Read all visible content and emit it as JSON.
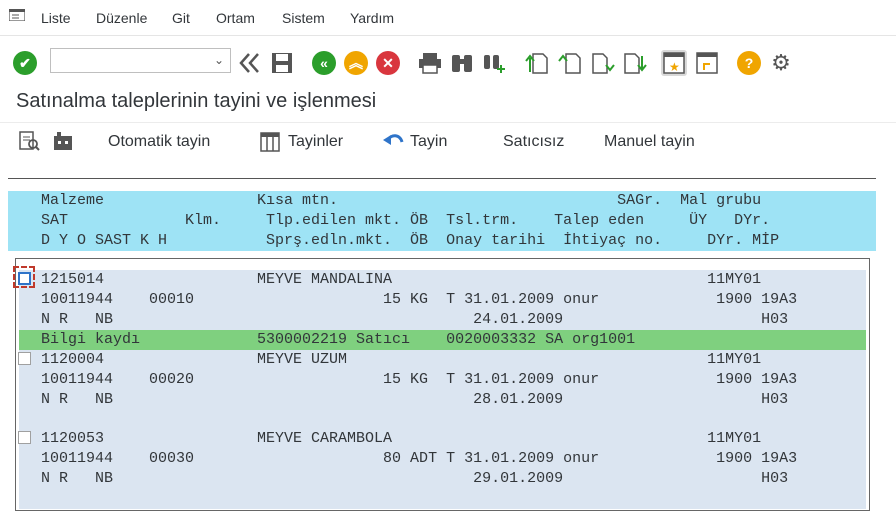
{
  "menu": [
    "Liste",
    "Düzenle",
    "Git",
    "Ortam",
    "Sistem",
    "Yardım"
  ],
  "toolbar": {
    "command_value": "",
    "colors": {
      "green": "#2b9e2b",
      "orange": "#f0a500",
      "red": "#d9363e",
      "gray": "#555555"
    }
  },
  "title": "Satınalma taleplerinin tayini ve işlenmesi",
  "app_toolbar": {
    "otomatik": "Otomatik tayin",
    "tayinler": "Tayinler",
    "tayin": "Tayin",
    "saticisiz": "Satıcısız",
    "manuel": "Manuel tayin"
  },
  "header": {
    "row1": "Malzeme                 Kısa mtn.                               SAGr.  Mal grubu",
    "row2": "SAT             Klm.     Tlp.edilen mkt. ÖB  Tsl.trm.    Talep eden     ÜY   DYr.",
    "row3": "D Y O SAST K H           Sprş.edln.mkt.  ÖB  Onay tarihi  İhtiyaç no.     DYr. MİP"
  },
  "items": [
    {
      "line1": "1215014                 MEYVE MANDALINA                                   11MY01",
      "line2": "10011944    00010                     15 KG  T 31.01.2009 onur             1900 19A3",
      "line3": "N R   NB                                        24.01.2009                      H03",
      "info": "Bilgi kaydı             5300002219 Satıcı    0020003332 SA org1001"
    },
    {
      "line1": "1120004                 MEYVE UZUM                                        11MY01",
      "line2": "10011944    00020                     15 KG  T 31.01.2009 onur             1900 19A3",
      "line3": "N R   NB                                        28.01.2009                      H03"
    },
    {
      "line1": "1120053                 MEYVE CARAMBOLA                                   11MY01",
      "line2": "10011944    00030                     80 ADT T 31.01.2009 onur             1900 19A3",
      "line3": "N R   NB                                        29.01.2009                      H03"
    }
  ]
}
